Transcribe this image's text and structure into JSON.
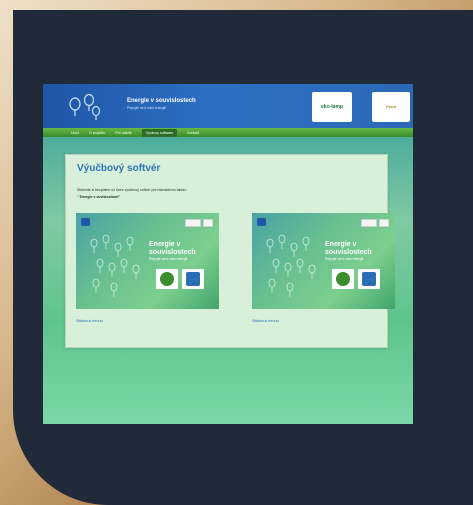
{
  "site": {
    "title": "Energie v souvislostech",
    "subtitle": "Pripojte se k nasi energii!",
    "partners": [
      "eko-lamp",
      "Fond"
    ]
  },
  "nav": {
    "items": [
      "Uvod",
      "O projektu",
      "Pro ucitele",
      "Vyukovy software",
      "Kontakt"
    ],
    "active_index": 3
  },
  "main": {
    "heading": "Výučbový softvér",
    "intro": "Stiahnite si bezplatne už dnes výučbový softvér pre interaktívnu tabuľu",
    "intro_bold": "\" Energie v súvislostiach\"",
    "cards": [
      {
        "title": "Energie v souvislostech",
        "subtitle": "Pripojte se k nasi energii",
        "link": "Stiahnuť verziu"
      },
      {
        "title": "Energie v souvislostech",
        "subtitle": "Pripojte se k nasi energii",
        "link": "Stiahnuť verziu"
      }
    ]
  },
  "colors": {
    "frame": "#212a39",
    "header": "#2b6fc3",
    "nav": "#4a9f34",
    "heading": "#2e74b8"
  },
  "icons": [
    "light-bulbs-icon",
    "ctrl-button-icon",
    "app-logo-icon"
  ]
}
